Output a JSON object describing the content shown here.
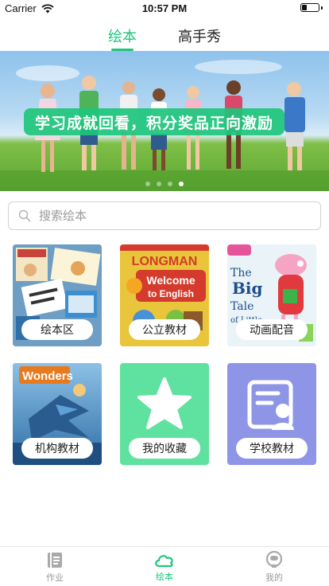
{
  "status_bar": {
    "carrier": "Carrier",
    "time": "10:57 PM"
  },
  "top_tabs": [
    {
      "label": "绘本",
      "active": true
    },
    {
      "label": "高手秀",
      "active": false
    }
  ],
  "banner": {
    "caption": "学习成就回看，积分奖品正向激励",
    "dots": 4,
    "active_dot": 3
  },
  "search": {
    "placeholder": "搜索绘本",
    "value": ""
  },
  "categories": [
    {
      "label": "绘本区",
      "icon": "picture-books-cover",
      "color": "#7aa7c9"
    },
    {
      "label": "公立教材",
      "icon": "longman-welcome-to-english-cover",
      "color": "#e8c53a",
      "cover_title_1": "LONGMAN",
      "cover_title_2": "Welcome",
      "cover_title_3": "to English"
    },
    {
      "label": "动画配音",
      "icon": "peppa-pig-cover",
      "color": "#e7f0f6",
      "cover_title_1": "The",
      "cover_title_2": "Big",
      "cover_title_3": "Tale",
      "cover_title_4": "of Little"
    },
    {
      "label": "机构教材",
      "icon": "wonders-cover",
      "color": "#4e87b8",
      "cover_title": "Wonders"
    },
    {
      "label": "我的收藏",
      "icon": "star-icon",
      "color": "#5fe29f"
    },
    {
      "label": "学校教材",
      "icon": "school-book-icon",
      "color": "#8e95e6"
    }
  ],
  "bottom_nav": [
    {
      "label": "作业",
      "icon": "homework-icon",
      "active": false
    },
    {
      "label": "绘本",
      "icon": "cloud-icon",
      "active": true
    },
    {
      "label": "我的",
      "icon": "profile-icon",
      "active": false
    }
  ],
  "colors": {
    "accent": "#1ec67c",
    "inactive": "#9a9a9a"
  }
}
